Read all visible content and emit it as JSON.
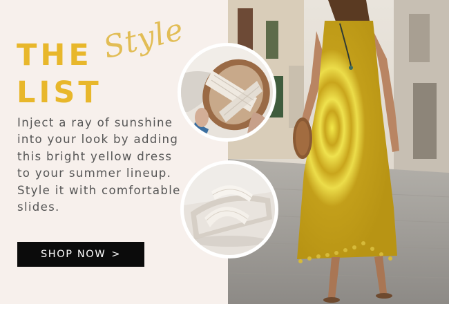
{
  "banner": {
    "title_line1": "THE",
    "title_line2": "LIST",
    "script_word": "Style",
    "body_text": "Inject a ray of sunshine into your look by adding this bright yellow dress to your summer lineup. Style it with comfortable slides.",
    "cta_label": "SHOP NOW",
    "cta_arrow": ">"
  },
  "colors": {
    "title": "#e8b72b",
    "script": "#e2bd55",
    "background": "#f7f0ec",
    "button": "#0b0b0b",
    "dress": "#c9a51c"
  },
  "images": {
    "hero": "woman-in-yellow-tie-dye-maxi-dress-photo",
    "detail_top": "woven-slide-sandal-closeup-photo",
    "detail_bottom": "white-woven-slide-sandal-photo"
  }
}
